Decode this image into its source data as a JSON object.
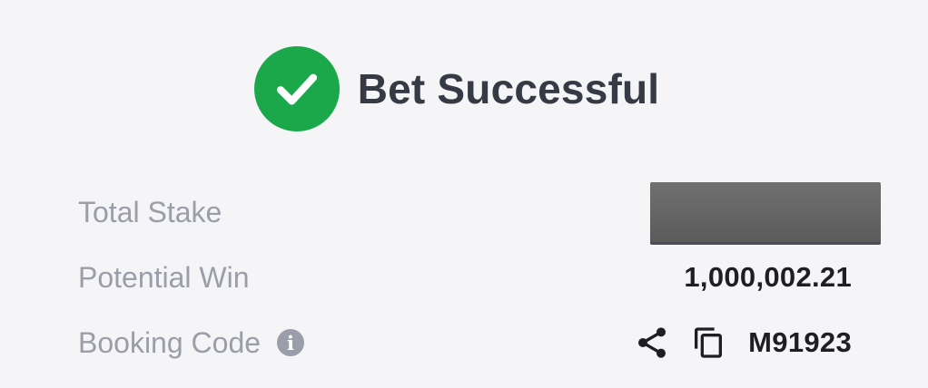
{
  "header": {
    "title": "Bet Successful",
    "icon": "check-circle-icon",
    "icon_color": "#1aa84b"
  },
  "rows": {
    "total_stake": {
      "label": "Total Stake",
      "value_redacted": true
    },
    "potential_win": {
      "label": "Potential Win",
      "value": "1,000,002.21"
    },
    "booking_code": {
      "label": "Booking Code",
      "info_icon": "info-icon",
      "share_icon": "share-icon",
      "copy_icon": "copy-icon",
      "value": "M91923"
    }
  },
  "colors": {
    "background": "#f5f5f7",
    "label": "#9a9ea8",
    "value": "#1d1f24",
    "title": "#353a45"
  }
}
